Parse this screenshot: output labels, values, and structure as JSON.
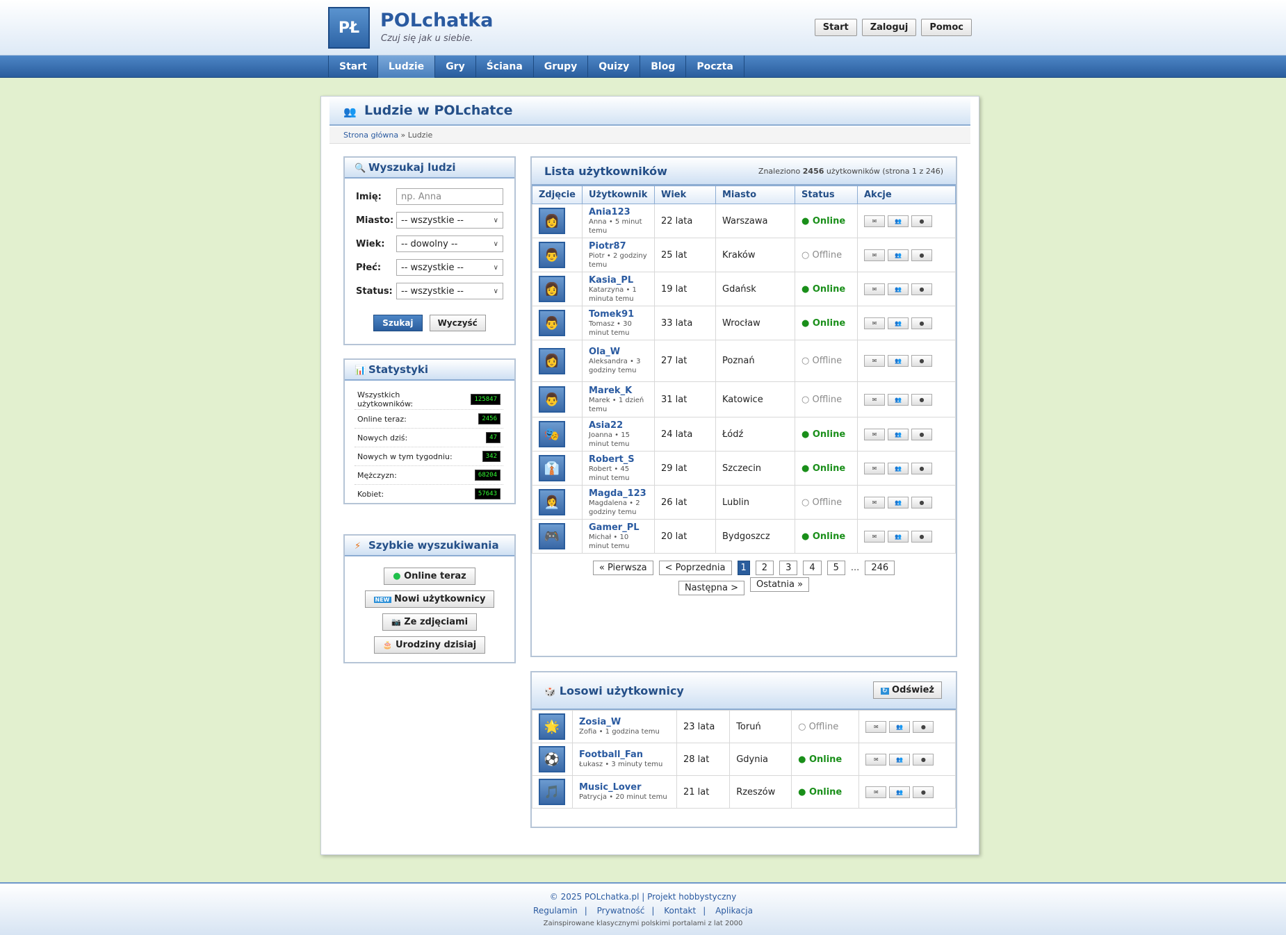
{
  "header": {
    "logo": "PŁ",
    "title": "POLchatka",
    "tagline": "Czuj się jak u siebie.",
    "buttons": [
      "Start",
      "Zaloguj",
      "Pomoc"
    ]
  },
  "nav": [
    "Start",
    "Ludzie",
    "Gry",
    "Ściana",
    "Grupy",
    "Quizy",
    "Blog",
    "Poczta"
  ],
  "page": {
    "title": "Ludzie w POLchatce",
    "breadcrumb_home": "Strona główna",
    "breadcrumb_sep": " » ",
    "breadcrumb_current": "Ludzie"
  },
  "search": {
    "title": "Wyszukaj ludzi",
    "name_label": "Imię:",
    "name_placeholder": "np. Anna",
    "city_label": "Miasto:",
    "city_value": "-- wszystkie --",
    "age_label": "Wiek:",
    "age_value": "-- dowolny --",
    "sex_label": "Płeć:",
    "sex_value": "-- wszystkie --",
    "status_label": "Status:",
    "status_value": "-- wszystkie --",
    "search_btn": "Szukaj",
    "clear_btn": "Wyczyść"
  },
  "stats": {
    "title": "Statystyki",
    "rows": [
      {
        "label": "Wszystkich użytkowników:",
        "value": "125847"
      },
      {
        "label": "Online teraz:",
        "value": "2456"
      },
      {
        "label": "Nowych dziś:",
        "value": "47"
      },
      {
        "label": "Nowych w tym tygodniu:",
        "value": "342"
      },
      {
        "label": "Mężczyzn:",
        "value": "68204"
      },
      {
        "label": "Kobiet:",
        "value": "57643"
      }
    ]
  },
  "quick": {
    "title": "Szybkie wyszukiwania",
    "buttons": [
      {
        "icon": "green-dot-icon",
        "label": "Online teraz"
      },
      {
        "icon": "new-badge-icon",
        "label": "Nowi użytkownicy"
      },
      {
        "icon": "camera-icon",
        "label": "Ze zdjęciami"
      },
      {
        "icon": "cake-icon",
        "label": "Urodziny dzisiaj"
      }
    ]
  },
  "users": {
    "title": "Lista użytkowników",
    "count_prefix": "Znaleziono ",
    "count": "2456",
    "count_suffix": " użytkowników (strona 1 z 246)",
    "columns": [
      "Zdjęcie",
      "Użytkownik",
      "Wiek",
      "Miasto",
      "Status",
      "Akcje"
    ],
    "rows": [
      {
        "avatar": "👩",
        "name": "Ania123",
        "meta": "Anna • 5 minut temu",
        "age": "22 lata",
        "city": "Warszawa",
        "status": "Online"
      },
      {
        "avatar": "👨",
        "name": "Piotr87",
        "meta": "Piotr • 2 godziny temu",
        "age": "25 lat",
        "city": "Kraków",
        "status": "Offline"
      },
      {
        "avatar": "👩",
        "name": "Kasia_PL",
        "meta": "Katarzyna • 1 minuta temu",
        "age": "19 lat",
        "city": "Gdańsk",
        "status": "Online"
      },
      {
        "avatar": "👨",
        "name": "Tomek91",
        "meta": "Tomasz • 30 minut temu",
        "age": "33 lata",
        "city": "Wrocław",
        "status": "Online"
      },
      {
        "avatar": "👩",
        "name": "Ola_W",
        "meta": "Aleksandra • 3 godziny temu",
        "age": "27 lat",
        "city": "Poznań",
        "status": "Offline"
      },
      {
        "avatar": "👨",
        "name": "Marek_K",
        "meta": "Marek • 1 dzień temu",
        "age": "31 lat",
        "city": "Katowice",
        "status": "Offline"
      },
      {
        "avatar": "🎭",
        "name": "Asia22",
        "meta": "Joanna • 15 minut temu",
        "age": "24 lata",
        "city": "Łódź",
        "status": "Online"
      },
      {
        "avatar": "👔",
        "name": "Robert_S",
        "meta": "Robert • 45 minut temu",
        "age": "29 lat",
        "city": "Szczecin",
        "status": "Online"
      },
      {
        "avatar": "👩‍💼",
        "name": "Magda_123",
        "meta": "Magdalena • 2 godziny temu",
        "age": "26 lat",
        "city": "Lublin",
        "status": "Offline"
      },
      {
        "avatar": "🎮",
        "name": "Gamer_PL",
        "meta": "Michał • 10 minut temu",
        "age": "20 lat",
        "city": "Bydgoszcz",
        "status": "Online"
      }
    ],
    "pager": {
      "first": "« Pierwsza",
      "prev": "< Poprzednia",
      "pages": [
        "1",
        "2",
        "3",
        "4",
        "5"
      ],
      "dots": "...",
      "last_page": "246",
      "next": "Następna >",
      "last": "Ostatnia »"
    }
  },
  "random": {
    "title": "Losowi użytkownicy",
    "refresh": "Odśwież",
    "rows": [
      {
        "avatar": "🌟",
        "name": "Zosia_W",
        "meta": "Zofia • 1 godzina temu",
        "age": "23 lata",
        "city": "Toruń",
        "status": "Offline"
      },
      {
        "avatar": "⚽",
        "name": "Football_Fan",
        "meta": "Łukasz • 3 minuty temu",
        "age": "28 lat",
        "city": "Gdynia",
        "status": "Online"
      },
      {
        "avatar": "🎵",
        "name": "Music_Lover",
        "meta": "Patrycja • 20 minut temu",
        "age": "21 lat",
        "city": "Rzeszów",
        "status": "Online"
      }
    ]
  },
  "footer": {
    "line1": "© 2025 POLchatka.pl | Projekt hobbystyczny",
    "links": [
      "Regulamin",
      "Prywatność",
      "Kontakt",
      "Aplikacja"
    ],
    "line3": "Zainspirowane klasycznymi polskimi portalami z lat 2000"
  }
}
